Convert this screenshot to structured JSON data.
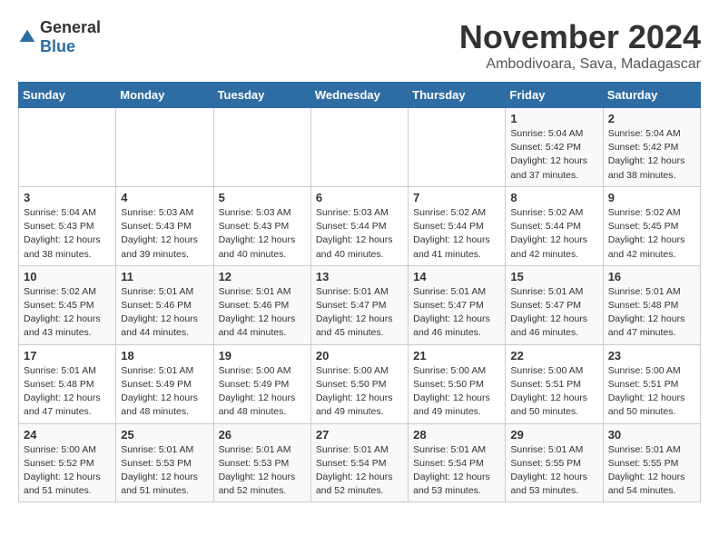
{
  "logo": {
    "general": "General",
    "blue": "Blue"
  },
  "title": "November 2024",
  "subtitle": "Ambodivoara, Sava, Madagascar",
  "headers": [
    "Sunday",
    "Monday",
    "Tuesday",
    "Wednesday",
    "Thursday",
    "Friday",
    "Saturday"
  ],
  "weeks": [
    [
      {
        "day": "",
        "info": ""
      },
      {
        "day": "",
        "info": ""
      },
      {
        "day": "",
        "info": ""
      },
      {
        "day": "",
        "info": ""
      },
      {
        "day": "",
        "info": ""
      },
      {
        "day": "1",
        "info": "Sunrise: 5:04 AM\nSunset: 5:42 PM\nDaylight: 12 hours\nand 37 minutes."
      },
      {
        "day": "2",
        "info": "Sunrise: 5:04 AM\nSunset: 5:42 PM\nDaylight: 12 hours\nand 38 minutes."
      }
    ],
    [
      {
        "day": "3",
        "info": "Sunrise: 5:04 AM\nSunset: 5:43 PM\nDaylight: 12 hours\nand 38 minutes."
      },
      {
        "day": "4",
        "info": "Sunrise: 5:03 AM\nSunset: 5:43 PM\nDaylight: 12 hours\nand 39 minutes."
      },
      {
        "day": "5",
        "info": "Sunrise: 5:03 AM\nSunset: 5:43 PM\nDaylight: 12 hours\nand 40 minutes."
      },
      {
        "day": "6",
        "info": "Sunrise: 5:03 AM\nSunset: 5:44 PM\nDaylight: 12 hours\nand 40 minutes."
      },
      {
        "day": "7",
        "info": "Sunrise: 5:02 AM\nSunset: 5:44 PM\nDaylight: 12 hours\nand 41 minutes."
      },
      {
        "day": "8",
        "info": "Sunrise: 5:02 AM\nSunset: 5:44 PM\nDaylight: 12 hours\nand 42 minutes."
      },
      {
        "day": "9",
        "info": "Sunrise: 5:02 AM\nSunset: 5:45 PM\nDaylight: 12 hours\nand 42 minutes."
      }
    ],
    [
      {
        "day": "10",
        "info": "Sunrise: 5:02 AM\nSunset: 5:45 PM\nDaylight: 12 hours\nand 43 minutes."
      },
      {
        "day": "11",
        "info": "Sunrise: 5:01 AM\nSunset: 5:46 PM\nDaylight: 12 hours\nand 44 minutes."
      },
      {
        "day": "12",
        "info": "Sunrise: 5:01 AM\nSunset: 5:46 PM\nDaylight: 12 hours\nand 44 minutes."
      },
      {
        "day": "13",
        "info": "Sunrise: 5:01 AM\nSunset: 5:47 PM\nDaylight: 12 hours\nand 45 minutes."
      },
      {
        "day": "14",
        "info": "Sunrise: 5:01 AM\nSunset: 5:47 PM\nDaylight: 12 hours\nand 46 minutes."
      },
      {
        "day": "15",
        "info": "Sunrise: 5:01 AM\nSunset: 5:47 PM\nDaylight: 12 hours\nand 46 minutes."
      },
      {
        "day": "16",
        "info": "Sunrise: 5:01 AM\nSunset: 5:48 PM\nDaylight: 12 hours\nand 47 minutes."
      }
    ],
    [
      {
        "day": "17",
        "info": "Sunrise: 5:01 AM\nSunset: 5:48 PM\nDaylight: 12 hours\nand 47 minutes."
      },
      {
        "day": "18",
        "info": "Sunrise: 5:01 AM\nSunset: 5:49 PM\nDaylight: 12 hours\nand 48 minutes."
      },
      {
        "day": "19",
        "info": "Sunrise: 5:00 AM\nSunset: 5:49 PM\nDaylight: 12 hours\nand 48 minutes."
      },
      {
        "day": "20",
        "info": "Sunrise: 5:00 AM\nSunset: 5:50 PM\nDaylight: 12 hours\nand 49 minutes."
      },
      {
        "day": "21",
        "info": "Sunrise: 5:00 AM\nSunset: 5:50 PM\nDaylight: 12 hours\nand 49 minutes."
      },
      {
        "day": "22",
        "info": "Sunrise: 5:00 AM\nSunset: 5:51 PM\nDaylight: 12 hours\nand 50 minutes."
      },
      {
        "day": "23",
        "info": "Sunrise: 5:00 AM\nSunset: 5:51 PM\nDaylight: 12 hours\nand 50 minutes."
      }
    ],
    [
      {
        "day": "24",
        "info": "Sunrise: 5:00 AM\nSunset: 5:52 PM\nDaylight: 12 hours\nand 51 minutes."
      },
      {
        "day": "25",
        "info": "Sunrise: 5:01 AM\nSunset: 5:53 PM\nDaylight: 12 hours\nand 51 minutes."
      },
      {
        "day": "26",
        "info": "Sunrise: 5:01 AM\nSunset: 5:53 PM\nDaylight: 12 hours\nand 52 minutes."
      },
      {
        "day": "27",
        "info": "Sunrise: 5:01 AM\nSunset: 5:54 PM\nDaylight: 12 hours\nand 52 minutes."
      },
      {
        "day": "28",
        "info": "Sunrise: 5:01 AM\nSunset: 5:54 PM\nDaylight: 12 hours\nand 53 minutes."
      },
      {
        "day": "29",
        "info": "Sunrise: 5:01 AM\nSunset: 5:55 PM\nDaylight: 12 hours\nand 53 minutes."
      },
      {
        "day": "30",
        "info": "Sunrise: 5:01 AM\nSunset: 5:55 PM\nDaylight: 12 hours\nand 54 minutes."
      }
    ]
  ]
}
